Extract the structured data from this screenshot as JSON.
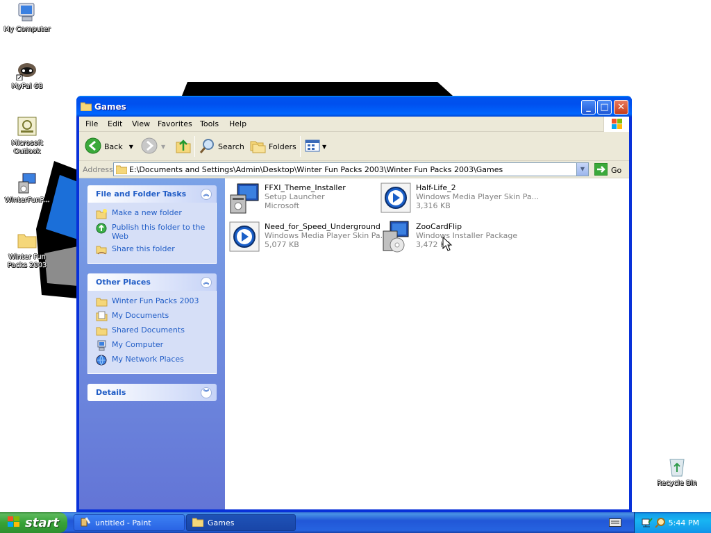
{
  "desktop": {
    "icons": [
      {
        "label": "My Computer",
        "icon": "my-computer-icon"
      },
      {
        "label": "MyPal 68",
        "icon": "mypal-raccoon-icon"
      },
      {
        "label": "Microsoft Outlook",
        "icon": "outlook-icon"
      },
      {
        "label": "WinterFunP...",
        "icon": "installer-icon"
      },
      {
        "label": "Winter Fun Packs 2003",
        "icon": "folder-icon"
      },
      {
        "label": "Recycle Bin",
        "icon": "recycle-bin-icon"
      }
    ]
  },
  "window": {
    "title": "Games",
    "menu": [
      "File",
      "Edit",
      "View",
      "Favorites",
      "Tools",
      "Help"
    ],
    "toolbar": {
      "back": "Back",
      "search": "Search",
      "folders": "Folders"
    },
    "address": {
      "label": "Address",
      "value": "E:\\Documents and Settings\\Admin\\Desktop\\Winter Fun Packs 2003\\Winter Fun Packs 2003\\Games",
      "go": "Go"
    },
    "tasks_panel": {
      "title": "File and Folder Tasks",
      "items": [
        "Make a new folder",
        "Publish this folder to the Web",
        "Share this folder"
      ]
    },
    "places_panel": {
      "title": "Other Places",
      "items": [
        "Winter Fun Packs 2003",
        "My Documents",
        "Shared Documents",
        "My Computer",
        "My Network Places"
      ]
    },
    "details_panel": {
      "title": "Details"
    },
    "files": [
      {
        "name": "FFXI_Theme_Installer",
        "line2": "Setup Launcher",
        "line3": "Microsoft",
        "icon": "setup-installer-icon"
      },
      {
        "name": "Half-Life_2",
        "line2": "Windows Media Player Skin Pa...",
        "line3": "3,316 KB",
        "icon": "media-player-skin-icon"
      },
      {
        "name": "Need_for_Speed_Underground",
        "line2": "Windows Media Player Skin Pa...",
        "line3": "5,077 KB",
        "icon": "media-player-skin-icon"
      },
      {
        "name": "ZooCardFlip",
        "line2": "Windows Installer Package",
        "line3": "3,472 KB",
        "icon": "msi-package-icon"
      }
    ]
  },
  "taskbar": {
    "start": "start",
    "tasks": [
      {
        "label": "untitled - Paint",
        "icon": "paint-icon",
        "active": false
      },
      {
        "label": "Games",
        "icon": "folder-icon",
        "active": true
      }
    ],
    "clock": "5:44 PM"
  }
}
